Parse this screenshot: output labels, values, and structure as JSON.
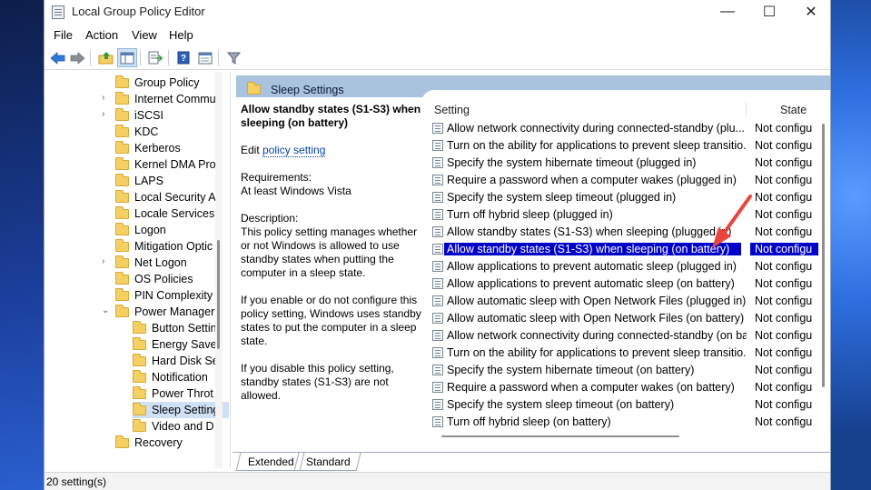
{
  "window": {
    "title": "Local Group Policy Editor",
    "controls": {
      "minimize": "—",
      "maximize": "☐",
      "close": "✕"
    }
  },
  "menu": [
    "File",
    "Action",
    "View",
    "Help"
  ],
  "toolbar": {
    "buttons": [
      "back-icon",
      "forward-icon",
      "up-folder-icon",
      "show-hide-tree-icon",
      "export-list-icon",
      "help-icon",
      "properties-icon",
      "filter-icon"
    ]
  },
  "tree": {
    "items": [
      {
        "label": "Group Policy",
        "expander": ""
      },
      {
        "label": "Internet Commu",
        "expander": "›"
      },
      {
        "label": "iSCSI",
        "expander": "›"
      },
      {
        "label": "KDC",
        "expander": ""
      },
      {
        "label": "Kerberos",
        "expander": ""
      },
      {
        "label": "Kernel DMA Pro",
        "expander": ""
      },
      {
        "label": "LAPS",
        "expander": ""
      },
      {
        "label": "Local Security A",
        "expander": ""
      },
      {
        "label": "Locale Services",
        "expander": ""
      },
      {
        "label": "Logon",
        "expander": ""
      },
      {
        "label": "Mitigation Optic",
        "expander": ""
      },
      {
        "label": "Net Logon",
        "expander": "›"
      },
      {
        "label": "OS Policies",
        "expander": ""
      },
      {
        "label": "PIN Complexity",
        "expander": ""
      },
      {
        "label": "Power Manager",
        "expander": "⌄"
      },
      {
        "label": "Button Settin",
        "expander": ""
      },
      {
        "label": "Energy Saver",
        "expander": ""
      },
      {
        "label": "Hard Disk Se",
        "expander": ""
      },
      {
        "label": "Notification",
        "expander": ""
      },
      {
        "label": "Power Throt",
        "expander": ""
      },
      {
        "label": "Sleep Setting",
        "expander": ""
      },
      {
        "label": "Video and D",
        "expander": ""
      },
      {
        "label": "Recovery",
        "expander": ""
      }
    ]
  },
  "pane": {
    "band_title": "Sleep Settings",
    "description": {
      "title": "Allow standby states (S1-S3) when sleeping (on battery)",
      "edit_prefix": "Edit",
      "edit_link": "policy setting",
      "requirements_label": "Requirements:",
      "requirements_value": "At least Windows Vista",
      "description_label": "Description:",
      "p1": "This policy setting manages whether or not Windows is allowed to use standby states when putting the computer in a sleep state.",
      "p2": "If you enable or do not configure this policy setting, Windows uses standby states to put the computer in a sleep state.",
      "p3": "If you disable this policy setting, standby states (S1-S3) are not allowed."
    },
    "columns": {
      "setting": "Setting",
      "state": "State"
    },
    "settings": [
      {
        "name": "Allow network connectivity during connected-standby (plu...",
        "state": "Not configu"
      },
      {
        "name": "Turn on the ability for applications to prevent sleep transitio...",
        "state": "Not configu"
      },
      {
        "name": "Specify the system hibernate timeout (plugged in)",
        "state": "Not configu"
      },
      {
        "name": "Require a password when a computer wakes (plugged in)",
        "state": "Not configu"
      },
      {
        "name": "Specify the system sleep timeout (plugged in)",
        "state": "Not configu"
      },
      {
        "name": "Turn off hybrid sleep (plugged in)",
        "state": "Not configu"
      },
      {
        "name": "Allow standby states (S1-S3) when sleeping (plugged in)",
        "state": "Not configu"
      },
      {
        "name": "Allow standby states (S1-S3) when sleeping (on battery)",
        "state": "Not configu"
      },
      {
        "name": "Allow applications to prevent automatic sleep (plugged in)",
        "state": "Not configu"
      },
      {
        "name": "Allow applications to prevent automatic sleep (on battery)",
        "state": "Not configu"
      },
      {
        "name": "Allow automatic sleep with Open Network Files (plugged in)",
        "state": "Not configu"
      },
      {
        "name": "Allow automatic sleep with Open Network Files (on battery)",
        "state": "Not configu"
      },
      {
        "name": "Allow network connectivity during connected-standby (on ba...",
        "state": "Not configu"
      },
      {
        "name": "Turn on the ability for applications to prevent sleep transitio...",
        "state": "Not configu"
      },
      {
        "name": "Specify the system hibernate timeout (on battery)",
        "state": "Not configu"
      },
      {
        "name": "Require a password when a computer wakes (on battery)",
        "state": "Not configu"
      },
      {
        "name": "Specify the system sleep timeout (on battery)",
        "state": "Not configu"
      },
      {
        "name": "Turn off hybrid sleep (on battery)",
        "state": "Not configu"
      }
    ],
    "selected_index": 7,
    "tabs": [
      "Extended",
      "Standard"
    ]
  },
  "status": {
    "text": "20 setting(s)"
  },
  "colors": {
    "selection": "#0000c8",
    "band": "#a9c2dd",
    "annotation_arrow": "#e8453c"
  }
}
